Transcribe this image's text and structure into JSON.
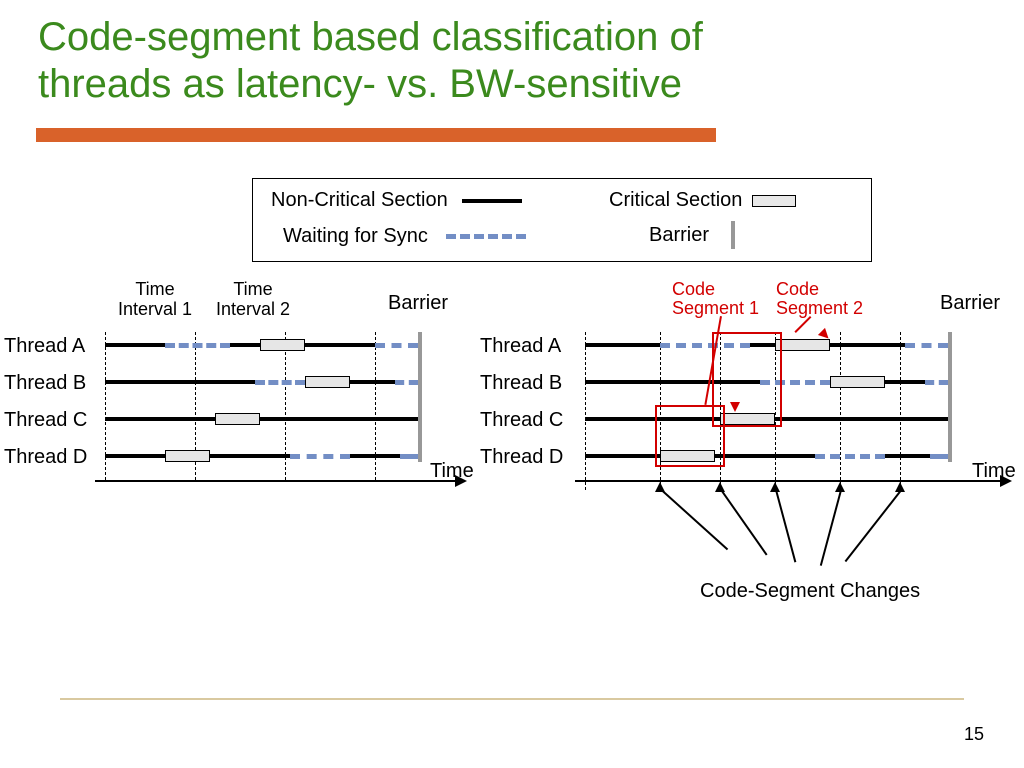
{
  "title_line1": "Code-segment based classification of",
  "title_line2": "threads as latency- vs. BW-sensitive",
  "legend": {
    "noncritical": "Non-Critical Section",
    "critical": "Critical Section",
    "waiting": "Waiting for Sync",
    "barrier": "Barrier"
  },
  "intervals": {
    "time_interval_1_line1": "Time",
    "time_interval_1_line2": "Interval 1",
    "time_interval_2_line1": "Time",
    "time_interval_2_line2": "Interval 2"
  },
  "threads": {
    "a": "Thread A",
    "b": "Thread B",
    "c": "Thread C",
    "d": "Thread D"
  },
  "labels": {
    "barrier": "Barrier",
    "time": "Time",
    "code_seg_1_l1": "Code",
    "code_seg_1_l2": "Segment 1",
    "code_seg_2_l1": "Code",
    "code_seg_2_l2": "Segment 2",
    "cs_changes": "Code-Segment Changes"
  },
  "page_number": "15"
}
